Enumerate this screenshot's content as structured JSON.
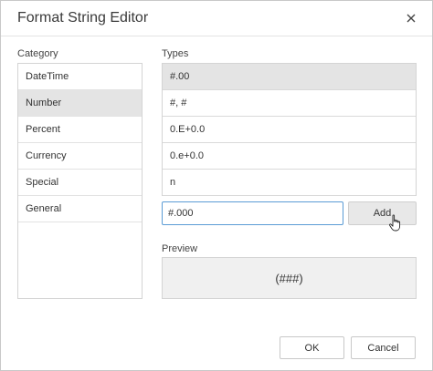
{
  "dialog": {
    "title": "Format String Editor",
    "close_icon": "close-icon"
  },
  "category": {
    "label": "Category",
    "items": [
      "DateTime",
      "Number",
      "Percent",
      "Currency",
      "Special",
      "General"
    ],
    "selected": "Number"
  },
  "types": {
    "label": "Types",
    "items": [
      "#.00",
      "#, #",
      "0.E+0.0",
      "0.e+0.0",
      "n"
    ],
    "selected": "#.00"
  },
  "format_input": {
    "value": "#.000"
  },
  "add_button": {
    "label": "Add"
  },
  "preview": {
    "label": "Preview",
    "value": "(###)"
  },
  "footer": {
    "ok_label": "OK",
    "cancel_label": "Cancel"
  },
  "colors": {
    "input_border": "#5b9bd5",
    "selected_row": "#e4e4e4",
    "preview_bg": "#f0f0f0"
  }
}
